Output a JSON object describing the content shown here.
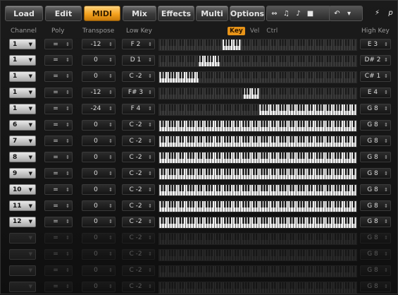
{
  "toolbar": {
    "tabs": [
      {
        "label": "Load",
        "active": false
      },
      {
        "label": "Edit",
        "active": false
      },
      {
        "label": "MIDI",
        "active": true
      },
      {
        "label": "Mix",
        "active": false
      },
      {
        "label": "Effects",
        "active": false
      },
      {
        "label": "Multi",
        "active": false
      },
      {
        "label": "Options",
        "active": false
      }
    ]
  },
  "headers": {
    "channel": "Channel",
    "poly": "Poly",
    "transpose": "Transpose",
    "low_key": "Low Key",
    "high_key": "High Key",
    "view_key": "Key",
    "view_vel": "Vel",
    "view_ctrl": "Ctrl"
  },
  "rows": [
    {
      "channel": "1",
      "poly": "=",
      "transpose": "-12",
      "low": "F 2",
      "high": "E 3",
      "range": [
        41,
        52
      ],
      "dim": false
    },
    {
      "channel": "1",
      "poly": "=",
      "transpose": "0",
      "low": "D 1",
      "high": "D# 2",
      "range": [
        26,
        39
      ],
      "dim": false
    },
    {
      "channel": "1",
      "poly": "=",
      "transpose": "0",
      "low": "C -2",
      "high": "C# 1",
      "range": [
        0,
        25
      ],
      "dim": false
    },
    {
      "channel": "1",
      "poly": "=",
      "transpose": "-12",
      "low": "F# 3",
      "high": "E 4",
      "range": [
        54,
        64
      ],
      "dim": false
    },
    {
      "channel": "1",
      "poly": "=",
      "transpose": "-24",
      "low": "F 4",
      "high": "G 8",
      "range": [
        65,
        127
      ],
      "dim": false
    },
    {
      "channel": "6",
      "poly": "=",
      "transpose": "0",
      "low": "C -2",
      "high": "G 8",
      "range": [
        0,
        127
      ],
      "dim": false
    },
    {
      "channel": "7",
      "poly": "=",
      "transpose": "0",
      "low": "C -2",
      "high": "G 8",
      "range": [
        0,
        127
      ],
      "dim": false
    },
    {
      "channel": "8",
      "poly": "=",
      "transpose": "0",
      "low": "C -2",
      "high": "G 8",
      "range": [
        0,
        127
      ],
      "dim": false
    },
    {
      "channel": "9",
      "poly": "=",
      "transpose": "0",
      "low": "C -2",
      "high": "G 8",
      "range": [
        0,
        127
      ],
      "dim": false
    },
    {
      "channel": "10",
      "poly": "=",
      "transpose": "0",
      "low": "C -2",
      "high": "G 8",
      "range": [
        0,
        127
      ],
      "dim": false
    },
    {
      "channel": "11",
      "poly": "=",
      "transpose": "0",
      "low": "C -2",
      "high": "G 8",
      "range": [
        0,
        127
      ],
      "dim": false
    },
    {
      "channel": "12",
      "poly": "=",
      "transpose": "0",
      "low": "C -2",
      "high": "G 8",
      "range": [
        0,
        127
      ],
      "dim": false
    },
    {
      "channel": "",
      "poly": "=",
      "transpose": "0",
      "low": "C -2",
      "high": "G 8",
      "range": [
        0,
        0
      ],
      "dim": true
    },
    {
      "channel": "",
      "poly": "=",
      "transpose": "0",
      "low": "C -2",
      "high": "G 8",
      "range": [
        0,
        0
      ],
      "dim": true
    },
    {
      "channel": "",
      "poly": "=",
      "transpose": "0",
      "low": "C -2",
      "high": "G 8",
      "range": [
        0,
        0
      ],
      "dim": true
    },
    {
      "channel": "",
      "poly": "=",
      "transpose": "0",
      "low": "C -2",
      "high": "G 8",
      "range": [
        0,
        0
      ],
      "dim": true
    }
  ]
}
